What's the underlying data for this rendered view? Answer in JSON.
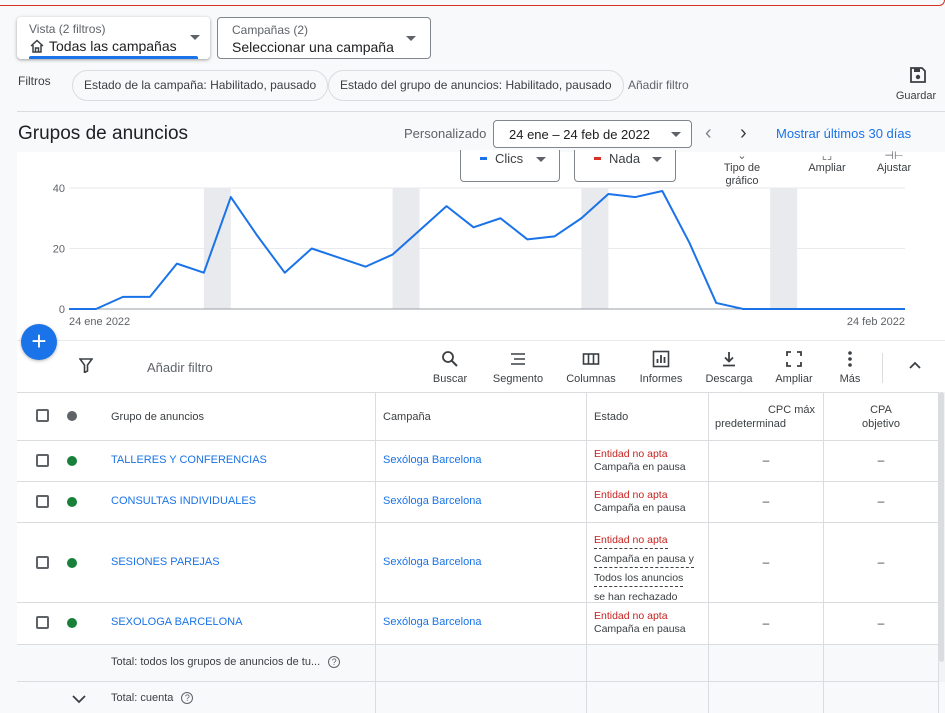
{
  "header": {
    "view_label": "Vista (2 filtros)",
    "view_value": "Todas las campañas",
    "campaigns_label": "Campañas (2)",
    "campaigns_value": "Seleccionar una campaña"
  },
  "filters": {
    "label": "Filtros",
    "chips": [
      "Estado de la campaña: Habilitado, pausado",
      "Estado del grupo de anuncios: Habilitado, pausado"
    ],
    "add_filter": "Añadir filtro",
    "save": "Guardar"
  },
  "page": {
    "title": "Grupos de anuncios",
    "date_mode": "Personalizado",
    "date_range": "24 ene – 24 feb de 2022",
    "show_last": "Mostrar últimos 30 días"
  },
  "chart_controls": {
    "metric1": "Clics",
    "metric1_color": "#1a73e8",
    "metric2": "Nada",
    "metric2_color": "#d93025",
    "tools": [
      {
        "label": "Tipo de gráfico",
        "icon": "chart-type-icon"
      },
      {
        "label": "Ampliar",
        "icon": "expand-icon"
      },
      {
        "label": "Ajustar",
        "icon": "adjust-icon"
      }
    ]
  },
  "chart_data": {
    "type": "line",
    "series": [
      {
        "name": "Clics",
        "color": "#1a73e8",
        "values": [
          0,
          0,
          4,
          4,
          15,
          12,
          37,
          24,
          12,
          20,
          17,
          14,
          18,
          26,
          34,
          27,
          30,
          23,
          24,
          30,
          38,
          37,
          39,
          22,
          2,
          0,
          0,
          0,
          0,
          0,
          0,
          0
        ]
      }
    ],
    "x_start_label": "24 ene 2022",
    "x_end_label": "24 feb 2022",
    "y_ticks": [
      0,
      20,
      40
    ],
    "ylim": [
      0,
      40
    ],
    "weekend_bands": [
      [
        5,
        6
      ],
      [
        12,
        13
      ],
      [
        19,
        20
      ],
      [
        26,
        27
      ]
    ],
    "grid": true
  },
  "toolbar": {
    "add_filter": "Añadir filtro",
    "buttons": [
      {
        "label": "Buscar",
        "icon": "search-icon"
      },
      {
        "label": "Segmento",
        "icon": "segment-icon"
      },
      {
        "label": "Columnas",
        "icon": "columns-icon"
      },
      {
        "label": "Informes",
        "icon": "reports-icon"
      },
      {
        "label": "Descarga",
        "icon": "download-icon"
      },
      {
        "label": "Ampliar",
        "icon": "expand-icon"
      },
      {
        "label": "Más",
        "icon": "more-icon"
      }
    ]
  },
  "table": {
    "headers": {
      "adgroup": "Grupo de anuncios",
      "campaign": "Campaña",
      "status": "Estado",
      "cpc_line1": "CPC máx",
      "cpc_line2": "predeterminad",
      "cpa_line1": "CPA",
      "cpa_line2": "objetivo"
    },
    "rows": [
      {
        "name": "TALLERES Y CONFERENCIAS",
        "campaign": "Sexóloga Barcelona",
        "status1": "Entidad no apta",
        "status2": "Campaña en pausa",
        "cpc": "–",
        "cpa": "–"
      },
      {
        "name": "CONSULTAS INDIVIDUALES",
        "campaign": "Sexóloga Barcelona",
        "status1": "Entidad no apta",
        "status2": "Campaña en pausa",
        "cpc": "–",
        "cpa": "–"
      },
      {
        "name": "SESIONES PAREJAS",
        "campaign": "Sexóloga Barcelona",
        "status1": "Entidad no apta",
        "status2a": "Campaña en pausa y",
        "status2b": "Todos los anuncios",
        "status2c": "se han rechazado",
        "cpc": "–",
        "cpa": "–"
      },
      {
        "name": "SEXOLOGA BARCELONA",
        "campaign": "Sexóloga Barcelona",
        "status1": "Entidad no apta",
        "status2": "Campaña en pausa",
        "cpc": "–",
        "cpa": "–"
      }
    ],
    "total_adgroups": "Total: todos los grupos de anuncios de tu...",
    "total_account": "Total: cuenta",
    "status_dot_color": "#188038"
  }
}
